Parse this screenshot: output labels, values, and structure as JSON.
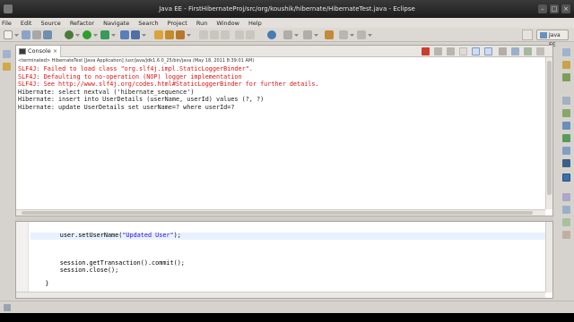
{
  "window": {
    "title": "Java EE - FirstHibernateProj/src/org/koushik/hibernate/HibernateTest.java - Eclipse"
  },
  "menu": [
    "File",
    "Edit",
    "Source",
    "Refactor",
    "Navigate",
    "Search",
    "Project",
    "Run",
    "Window",
    "Help"
  ],
  "perspective": {
    "label": "Java EE"
  },
  "console": {
    "tab_label": "Console",
    "status": "<terminated> HibernateTest [Java Application] /usr/java/jdk1.6.0_25/bin/java (May 18, 2011 8:39:01 AM)",
    "lines": [
      {
        "text": "SLF4J: Failed to load class \"org.slf4j.impl.StaticLoggerBinder\".",
        "type": "err"
      },
      {
        "text": "SLF4J: Defaulting to no-operation (NOP) logger implementation",
        "type": "err"
      },
      {
        "text": "SLF4J: See http://www.slf4j.org/codes.html#StaticLoggerBinder for further details.",
        "type": "err"
      },
      {
        "text": "Hibernate: select nextval ('hibernate_sequence')",
        "type": "out"
      },
      {
        "text": "Hibernate: insert into UserDetails (userName, userId) values (?, ?)",
        "type": "out"
      },
      {
        "text": "Hibernate: update UserDetails set userName=? where userId=?",
        "type": "out"
      }
    ]
  },
  "editor": {
    "lines": [
      {
        "indent": "",
        "code": "",
        "str": "",
        "after": ""
      },
      {
        "indent": "        ",
        "code": "user.setUserName(",
        "str": "\"Updated User\"",
        "after": ");"
      },
      {
        "indent": "",
        "code": "",
        "str": "",
        "after": ""
      },
      {
        "indent": "",
        "code": "",
        "str": "",
        "after": ""
      },
      {
        "indent": "",
        "code": "",
        "str": "",
        "after": ""
      },
      {
        "indent": "        ",
        "code": "session.getTransaction().commit();",
        "str": "",
        "after": ""
      },
      {
        "indent": "        ",
        "code": "session.close();",
        "str": "",
        "after": ""
      },
      {
        "indent": "",
        "code": "",
        "str": "",
        "after": ""
      },
      {
        "indent": "    ",
        "code": "}",
        "str": "",
        "after": ""
      },
      {
        "indent": "",
        "code": "",
        "str": "",
        "after": ""
      },
      {
        "indent": "",
        "code": "}",
        "str": "",
        "after": ""
      }
    ],
    "current_line": 1
  },
  "colors": {
    "error_text": "#dd1111",
    "string_literal": "#2a00ff",
    "current_line": "#e8f2fe"
  }
}
